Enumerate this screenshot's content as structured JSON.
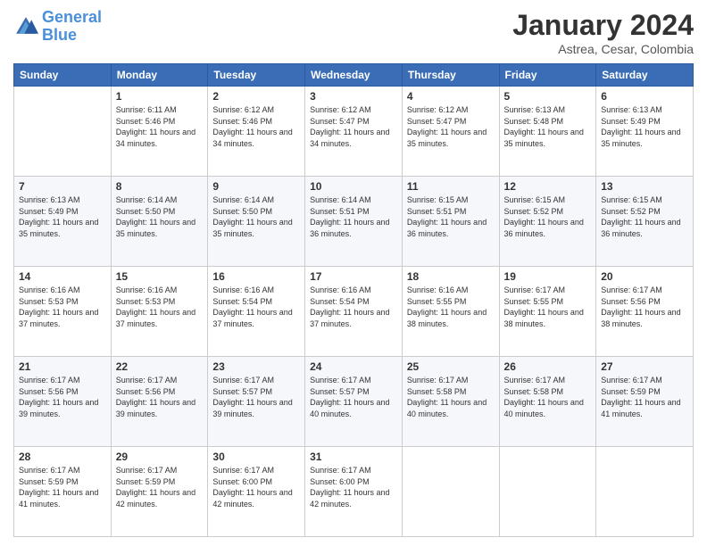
{
  "logo": {
    "line1": "General",
    "line2": "Blue"
  },
  "title": "January 2024",
  "subtitle": "Astrea, Cesar, Colombia",
  "days_of_week": [
    "Sunday",
    "Monday",
    "Tuesday",
    "Wednesday",
    "Thursday",
    "Friday",
    "Saturday"
  ],
  "weeks": [
    [
      {
        "day": "",
        "sunrise": "",
        "sunset": "",
        "daylight": ""
      },
      {
        "day": "1",
        "sunrise": "Sunrise: 6:11 AM",
        "sunset": "Sunset: 5:46 PM",
        "daylight": "Daylight: 11 hours and 34 minutes."
      },
      {
        "day": "2",
        "sunrise": "Sunrise: 6:12 AM",
        "sunset": "Sunset: 5:46 PM",
        "daylight": "Daylight: 11 hours and 34 minutes."
      },
      {
        "day": "3",
        "sunrise": "Sunrise: 6:12 AM",
        "sunset": "Sunset: 5:47 PM",
        "daylight": "Daylight: 11 hours and 34 minutes."
      },
      {
        "day": "4",
        "sunrise": "Sunrise: 6:12 AM",
        "sunset": "Sunset: 5:47 PM",
        "daylight": "Daylight: 11 hours and 35 minutes."
      },
      {
        "day": "5",
        "sunrise": "Sunrise: 6:13 AM",
        "sunset": "Sunset: 5:48 PM",
        "daylight": "Daylight: 11 hours and 35 minutes."
      },
      {
        "day": "6",
        "sunrise": "Sunrise: 6:13 AM",
        "sunset": "Sunset: 5:49 PM",
        "daylight": "Daylight: 11 hours and 35 minutes."
      }
    ],
    [
      {
        "day": "7",
        "sunrise": "Sunrise: 6:13 AM",
        "sunset": "Sunset: 5:49 PM",
        "daylight": "Daylight: 11 hours and 35 minutes."
      },
      {
        "day": "8",
        "sunrise": "Sunrise: 6:14 AM",
        "sunset": "Sunset: 5:50 PM",
        "daylight": "Daylight: 11 hours and 35 minutes."
      },
      {
        "day": "9",
        "sunrise": "Sunrise: 6:14 AM",
        "sunset": "Sunset: 5:50 PM",
        "daylight": "Daylight: 11 hours and 35 minutes."
      },
      {
        "day": "10",
        "sunrise": "Sunrise: 6:14 AM",
        "sunset": "Sunset: 5:51 PM",
        "daylight": "Daylight: 11 hours and 36 minutes."
      },
      {
        "day": "11",
        "sunrise": "Sunrise: 6:15 AM",
        "sunset": "Sunset: 5:51 PM",
        "daylight": "Daylight: 11 hours and 36 minutes."
      },
      {
        "day": "12",
        "sunrise": "Sunrise: 6:15 AM",
        "sunset": "Sunset: 5:52 PM",
        "daylight": "Daylight: 11 hours and 36 minutes."
      },
      {
        "day": "13",
        "sunrise": "Sunrise: 6:15 AM",
        "sunset": "Sunset: 5:52 PM",
        "daylight": "Daylight: 11 hours and 36 minutes."
      }
    ],
    [
      {
        "day": "14",
        "sunrise": "Sunrise: 6:16 AM",
        "sunset": "Sunset: 5:53 PM",
        "daylight": "Daylight: 11 hours and 37 minutes."
      },
      {
        "day": "15",
        "sunrise": "Sunrise: 6:16 AM",
        "sunset": "Sunset: 5:53 PM",
        "daylight": "Daylight: 11 hours and 37 minutes."
      },
      {
        "day": "16",
        "sunrise": "Sunrise: 6:16 AM",
        "sunset": "Sunset: 5:54 PM",
        "daylight": "Daylight: 11 hours and 37 minutes."
      },
      {
        "day": "17",
        "sunrise": "Sunrise: 6:16 AM",
        "sunset": "Sunset: 5:54 PM",
        "daylight": "Daylight: 11 hours and 37 minutes."
      },
      {
        "day": "18",
        "sunrise": "Sunrise: 6:16 AM",
        "sunset": "Sunset: 5:55 PM",
        "daylight": "Daylight: 11 hours and 38 minutes."
      },
      {
        "day": "19",
        "sunrise": "Sunrise: 6:17 AM",
        "sunset": "Sunset: 5:55 PM",
        "daylight": "Daylight: 11 hours and 38 minutes."
      },
      {
        "day": "20",
        "sunrise": "Sunrise: 6:17 AM",
        "sunset": "Sunset: 5:56 PM",
        "daylight": "Daylight: 11 hours and 38 minutes."
      }
    ],
    [
      {
        "day": "21",
        "sunrise": "Sunrise: 6:17 AM",
        "sunset": "Sunset: 5:56 PM",
        "daylight": "Daylight: 11 hours and 39 minutes."
      },
      {
        "day": "22",
        "sunrise": "Sunrise: 6:17 AM",
        "sunset": "Sunset: 5:56 PM",
        "daylight": "Daylight: 11 hours and 39 minutes."
      },
      {
        "day": "23",
        "sunrise": "Sunrise: 6:17 AM",
        "sunset": "Sunset: 5:57 PM",
        "daylight": "Daylight: 11 hours and 39 minutes."
      },
      {
        "day": "24",
        "sunrise": "Sunrise: 6:17 AM",
        "sunset": "Sunset: 5:57 PM",
        "daylight": "Daylight: 11 hours and 40 minutes."
      },
      {
        "day": "25",
        "sunrise": "Sunrise: 6:17 AM",
        "sunset": "Sunset: 5:58 PM",
        "daylight": "Daylight: 11 hours and 40 minutes."
      },
      {
        "day": "26",
        "sunrise": "Sunrise: 6:17 AM",
        "sunset": "Sunset: 5:58 PM",
        "daylight": "Daylight: 11 hours and 40 minutes."
      },
      {
        "day": "27",
        "sunrise": "Sunrise: 6:17 AM",
        "sunset": "Sunset: 5:59 PM",
        "daylight": "Daylight: 11 hours and 41 minutes."
      }
    ],
    [
      {
        "day": "28",
        "sunrise": "Sunrise: 6:17 AM",
        "sunset": "Sunset: 5:59 PM",
        "daylight": "Daylight: 11 hours and 41 minutes."
      },
      {
        "day": "29",
        "sunrise": "Sunrise: 6:17 AM",
        "sunset": "Sunset: 5:59 PM",
        "daylight": "Daylight: 11 hours and 42 minutes."
      },
      {
        "day": "30",
        "sunrise": "Sunrise: 6:17 AM",
        "sunset": "Sunset: 6:00 PM",
        "daylight": "Daylight: 11 hours and 42 minutes."
      },
      {
        "day": "31",
        "sunrise": "Sunrise: 6:17 AM",
        "sunset": "Sunset: 6:00 PM",
        "daylight": "Daylight: 11 hours and 42 minutes."
      },
      {
        "day": "",
        "sunrise": "",
        "sunset": "",
        "daylight": ""
      },
      {
        "day": "",
        "sunrise": "",
        "sunset": "",
        "daylight": ""
      },
      {
        "day": "",
        "sunrise": "",
        "sunset": "",
        "daylight": ""
      }
    ]
  ]
}
